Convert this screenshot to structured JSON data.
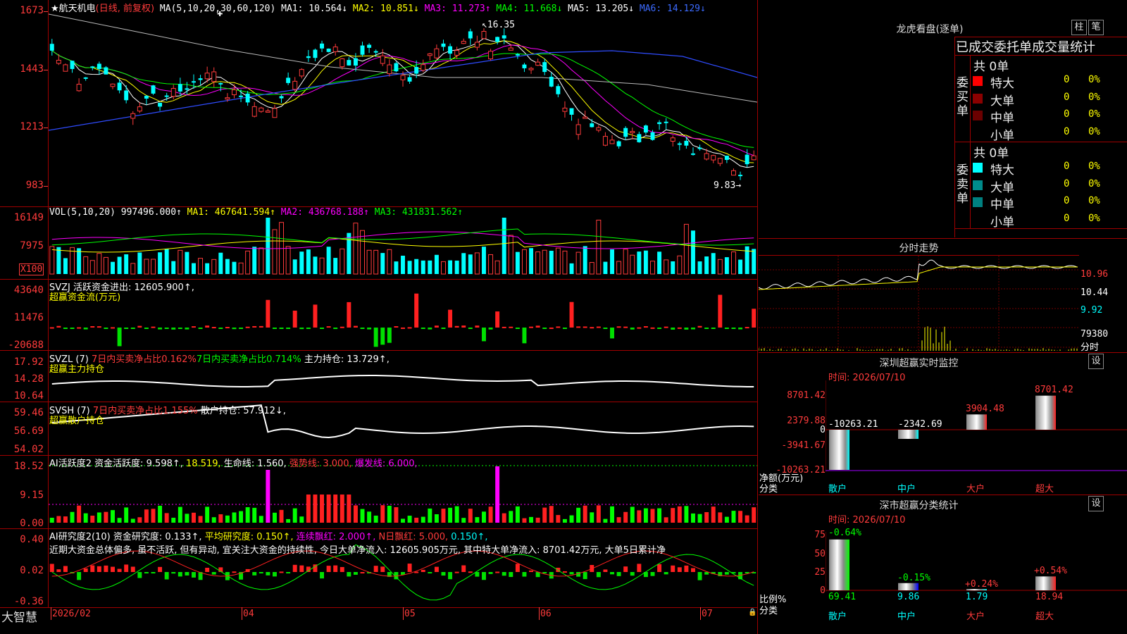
{
  "stock": {
    "star": "★",
    "name": "航天机电",
    "mode": "(日线, 前复权)"
  },
  "ma_header": {
    "params": "MA(5,10,20,30,60,120)",
    "ma1": "MA1: 10.564↓",
    "ma2": "MA2: 10.851↓",
    "ma3": "MA3: 11.273↑",
    "ma4": "MA4: 11.668↓",
    "ma5": "MA5: 13.205↓",
    "ma6": "MA6: 14.129↓"
  },
  "price_axis": [
    "1673",
    "1443",
    "1213",
    "983"
  ],
  "price_marks": {
    "high": "16.35",
    "low": "9.83"
  },
  "vol_header": {
    "params": "VOL(5,10,20)",
    "value": "997496.000↑",
    "ma1": "MA1: 467641.594↑",
    "ma2": "MA2: 436768.188↑",
    "ma3": "MA3: 431831.562↑"
  },
  "vol_axis": [
    "16149",
    "7975"
  ],
  "vol_unit": "X100",
  "svzj": {
    "header": "SVZJ  活跃资金进出: 12605.900↑,",
    "subtitle": "超赢资金流(万元)",
    "axis": [
      "43640",
      "11476",
      "-20688"
    ]
  },
  "svzl": {
    "params": "SVZL (7)",
    "p1": "7日内买卖净占比0.162%",
    "p2": "7日内买卖净占比0.714%",
    "p3": "主力持仓: 13.729↑,",
    "subtitle": "超赢主力持仓",
    "axis": [
      "17.92",
      "14.28",
      "10.64"
    ]
  },
  "svsh": {
    "params": "SVSH (7)",
    "p1": "7日内买卖净占比1.155%",
    "p2": "散户持仓: 57.912↓,",
    "subtitle": "超赢散户持仓",
    "axis": [
      "59.46",
      "56.69",
      "54.02"
    ]
  },
  "ai_act": {
    "p0": "AI活跃度2 资金活跃度: 9.598↑,",
    "p1": "18.519,",
    "p2": "生命线: 1.560,",
    "p3": "强势线: 3.000,",
    "p4": "爆发线: 6.000,",
    "axis": [
      "18.52",
      "9.15",
      "0.00"
    ]
  },
  "ai_res": {
    "p0": "AI研究度2(10) 资金研究度: 0.133↑,",
    "p1": "平均研究度: 0.150↑,",
    "p2": "连续飘红: 2.000↑,",
    "p3": "N日飘红: 5.000,",
    "p4": "0.150↑,",
    "axis": [
      "0.40",
      "0.02",
      "-0.36"
    ]
  },
  "commentary": "近期大资金总体偏多, 虽不活跃, 但有异动, 宜关注大资金的持续性, 今日大单净流入: 12605.905万元, 其中特大单净流入: 8701.42万元, 大单5日累计净",
  "bottom": {
    "brand": "大智慧",
    "dates": [
      "2026/02",
      "04",
      "05",
      "06",
      "07"
    ]
  },
  "right": {
    "lhkp_title": "龙虎看盘(逐单)",
    "btn_zhu": "柱",
    "btn_bi": "笔",
    "tabs_text": "已成交委托单成交量统计",
    "buy_label": "委买单",
    "sell_label": "委卖单",
    "buy_total": "共 0单",
    "sell_total": "共 0单",
    "buy_rows": [
      {
        "name": "特大",
        "v": "0",
        "p": "0%",
        "color": "#ff0000"
      },
      {
        "name": "大单",
        "v": "0",
        "p": "0%",
        "color": "#8b0000"
      },
      {
        "name": "中单",
        "v": "0",
        "p": "0%",
        "color": "#6b0000"
      },
      {
        "name": "小单",
        "v": "0",
        "p": "0%",
        "color": ""
      }
    ],
    "sell_rows": [
      {
        "name": "特大",
        "v": "0",
        "p": "0%",
        "color": "#00ffff"
      },
      {
        "name": "大单",
        "v": "0",
        "p": "0%",
        "color": "#008b8b"
      },
      {
        "name": "中单",
        "v": "0",
        "p": "0%",
        "color": "#008080"
      },
      {
        "name": "小单",
        "v": "0",
        "p": "0%",
        "color": ""
      }
    ],
    "fszs_title": "分时走势",
    "fszs_axis": [
      "10.96",
      "10.44",
      "9.92",
      "79380"
    ],
    "fszs_unit": "分时",
    "szcy_title": "深圳超赢实时监控",
    "set_label": "设",
    "szcy_time": "时间: 2026/07/10",
    "szcy_axis": [
      "8701.42",
      "2379.88",
      "0",
      "-3941.67",
      "-10263.21"
    ],
    "szcy_vals": [
      "-10263.21",
      "-2342.69",
      "3904.48",
      "8701.42"
    ],
    "szcy_left_labels": [
      "净额(万元)",
      "分类"
    ],
    "cats": [
      "散户",
      "中户",
      "大户",
      "超大"
    ],
    "sccy_title": "深市超赢分类统计",
    "sccy_time": "时间: 2026/07/10",
    "sccy_axis": [
      "75",
      "50",
      "25",
      "0"
    ],
    "sccy_pcts": [
      "-0.64%",
      "-0.15%",
      "+0.24%",
      "+0.54%"
    ],
    "sccy_vals": [
      "69.41",
      "9.86",
      "1.79",
      "18.94"
    ],
    "sccy_left_labels": [
      "比例%",
      "分类"
    ]
  }
}
